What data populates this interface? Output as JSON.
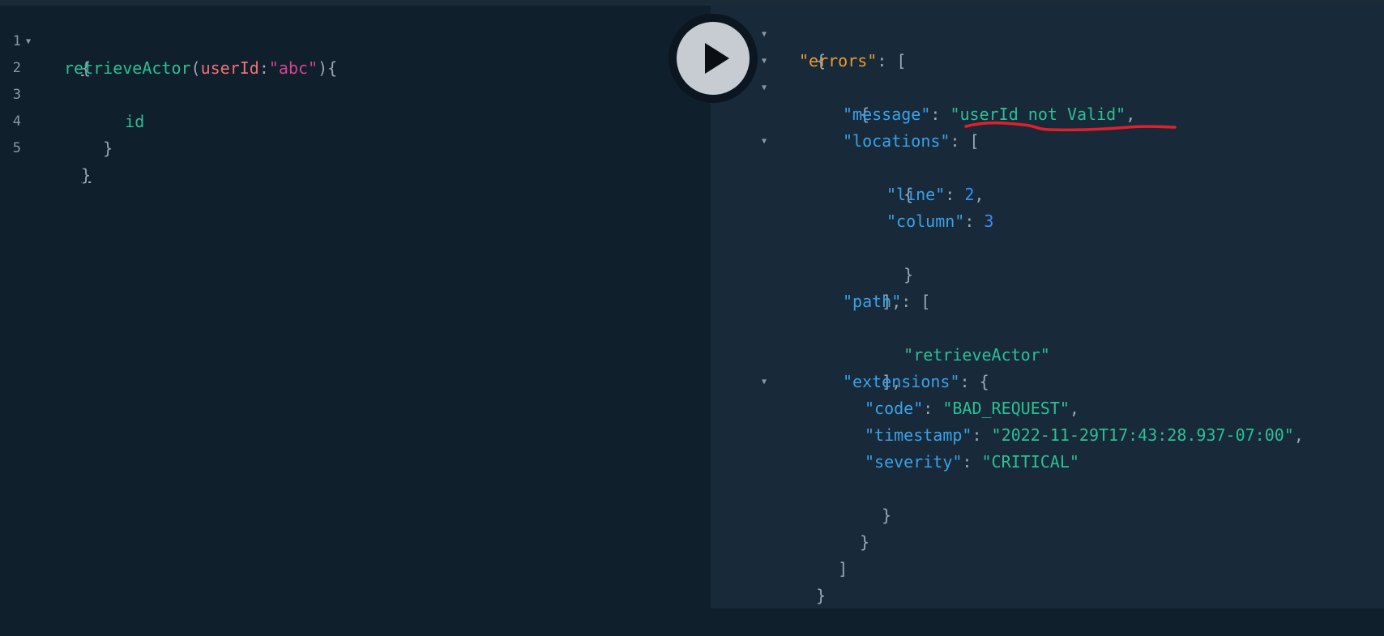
{
  "query_editor": {
    "line_numbers": [
      "1",
      "2",
      "3",
      "4",
      "5"
    ],
    "line1": {
      "open_brace": "{"
    },
    "line2": {
      "field": "retrieveActor",
      "open_paren": "(",
      "arg_name": "userId",
      "colon": ":",
      "arg_value": "\"abc\"",
      "close_paren_brace": "){"
    },
    "line3": {
      "field": "id"
    },
    "line4": {
      "close_brace": "}"
    },
    "line5": {
      "close_brace": "}"
    }
  },
  "run_button": {
    "icon": "play-icon"
  },
  "result": {
    "open_root": "{",
    "errors_key": "\"errors\"",
    "colon_bracket": ": [",
    "open_error": "{",
    "message_key": "\"message\"",
    "colon": ": ",
    "message_value": "\"userId not Valid\"",
    "comma": ",",
    "locations_key": "\"locations\"",
    "open_location": "{",
    "line_key": "\"line\"",
    "line_value": "2",
    "column_key": "\"column\"",
    "column_value": "3",
    "close_location": "}",
    "close_locations": "],",
    "path_key": "\"path\"",
    "path_item": "\"retrieveActor\"",
    "close_path": "],",
    "extensions_key": "\"extensions\"",
    "colon_brace": ": {",
    "code_key": "\"code\"",
    "code_value": "\"BAD_REQUEST\"",
    "timestamp_key": "\"timestamp\"",
    "timestamp_value": "\"2022-11-29T17:43:28.937-07:00\"",
    "severity_key": "\"severity\"",
    "severity_value": "\"CRITICAL\"",
    "close_extensions": "}",
    "close_error": "}",
    "close_errors": "]",
    "close_root": "}"
  },
  "annotation_color": "#e0202a"
}
